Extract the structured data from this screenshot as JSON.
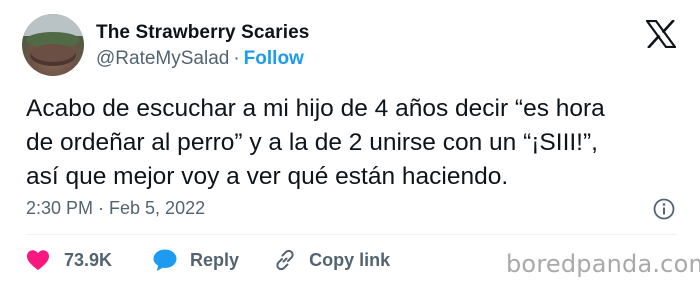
{
  "author": {
    "name": "The Strawberry Scaries",
    "handle": "@RateMySalad",
    "separator": "·",
    "follow_label": "Follow"
  },
  "tweet": {
    "lines": [
      "Acabo de escuchar a mi hijo de 4 años decir “es hora",
      "de ordeñar al perro” y a la de 2 unirse con un “¡SIII!”,",
      "así que mejor voy a ver qué están haciendo."
    ],
    "timestamp": "2:30 PM · Feb 5, 2022"
  },
  "actions": {
    "likes_count": "73.9K",
    "reply_label": "Reply",
    "copy_label": "Copy link"
  },
  "watermark": "boredpanda.com",
  "icons": {
    "logo": "x-logo-icon",
    "info": "info-icon",
    "like": "heart-icon",
    "reply": "speech-bubble-icon",
    "copy": "link-icon"
  },
  "colors": {
    "text": "#0f1419",
    "secondary": "#536471",
    "accent": "#1d9bf0",
    "like": "#f91880"
  }
}
